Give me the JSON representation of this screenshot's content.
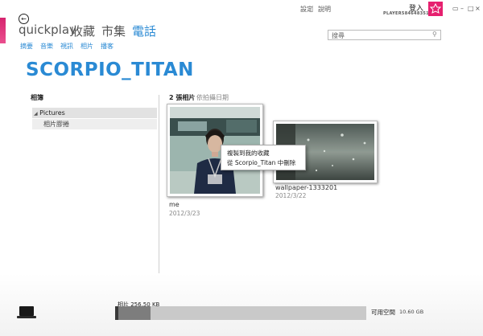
{
  "header": {
    "pivots": [
      "quickplay",
      "收藏",
      "市集",
      "電話"
    ],
    "active_pivot": "電話",
    "subnav": [
      "摘要",
      "音樂",
      "視訊",
      "相片",
      "播客"
    ],
    "top_links": [
      "設定",
      "說明"
    ],
    "login_label": "登入",
    "player_name": "PLAYER584648351",
    "search_placeholder": "搜尋",
    "accent_color": "#2a8ad4",
    "brand_color": "#e6206f"
  },
  "device": {
    "title": "SCORPIO_TITAN"
  },
  "sidebar": {
    "heading": "相簿",
    "tree": [
      {
        "label": "Pictures",
        "expanded": true
      },
      {
        "label": "相片膠捲"
      }
    ]
  },
  "content": {
    "count_label": "2 張相片",
    "sort_label": "依拍攝日期",
    "photos": [
      {
        "name": "me",
        "date": "2012/3/23",
        "icon": "portrait-photo"
      },
      {
        "name": "wallpaper-1333201",
        "date": "2012/3/22",
        "icon": "rainy-window-photo"
      }
    ]
  },
  "context_menu": {
    "items": [
      "複製到我的收藏",
      "從 Scorpio_Titan 中刪除"
    ]
  },
  "footer": {
    "storage_label": "相片 256.50 KB",
    "storage_used_fraction": 0.015,
    "free_label": "可用空間",
    "free_value": "10.60 GB",
    "device_icon": "phone-device-icon"
  }
}
